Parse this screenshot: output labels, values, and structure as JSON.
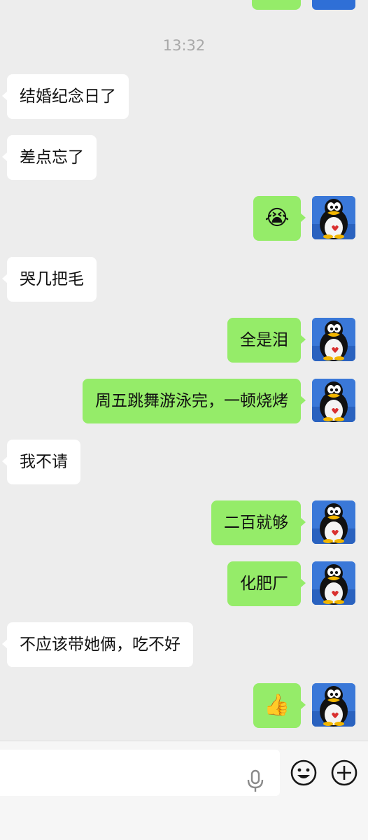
{
  "timestamp": "13:32",
  "messages": [
    {
      "side": "left",
      "text": "结婚纪念日了"
    },
    {
      "side": "left",
      "text": "差点忘了"
    },
    {
      "side": "right",
      "text": "😭"
    },
    {
      "side": "left",
      "text": "哭几把毛"
    },
    {
      "side": "right",
      "text": "全是泪"
    },
    {
      "side": "right",
      "text": "周五跳舞游泳完，一顿烧烤"
    },
    {
      "side": "left",
      "text": "我不请"
    },
    {
      "side": "right",
      "text": "二百就够"
    },
    {
      "side": "right",
      "text": "化肥厂"
    },
    {
      "side": "left",
      "text": "不应该带她俩，吃不好"
    },
    {
      "side": "right",
      "text": "👍"
    }
  ],
  "colors": {
    "background": "#ededed",
    "bubble_self": "#95ec69",
    "bubble_other": "#ffffff",
    "timestamp": "#a8a8a8"
  },
  "icons": {
    "self_avatar": "penguin-avatar",
    "voice": "microphone-icon",
    "emoji": "emoji-smile-icon",
    "more": "plus-icon"
  }
}
